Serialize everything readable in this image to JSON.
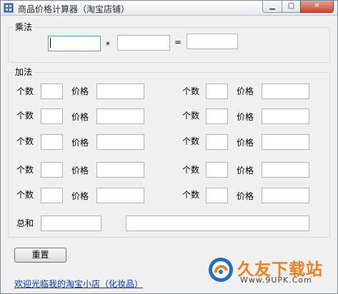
{
  "window": {
    "title": "商品价格计算器（淘宝店铺）",
    "min_icon": "minimize-icon",
    "max_icon": "maximize-icon",
    "close_icon": "close-icon"
  },
  "multiply": {
    "group_label": "乘法",
    "operand1": "",
    "operator": "*",
    "operand2": "",
    "equals": "=",
    "result": ""
  },
  "add": {
    "group_label": "加法",
    "count_label": "个数",
    "price_label": "价格",
    "rows_left": [
      {
        "count": "",
        "price": ""
      },
      {
        "count": "",
        "price": ""
      },
      {
        "count": "",
        "price": ""
      },
      {
        "count": "",
        "price": ""
      },
      {
        "count": "",
        "price": ""
      }
    ],
    "rows_right": [
      {
        "count": "",
        "price": ""
      },
      {
        "count": "",
        "price": ""
      },
      {
        "count": "",
        "price": ""
      },
      {
        "count": "",
        "price": ""
      },
      {
        "count": "",
        "price": ""
      }
    ],
    "total_label": "总和",
    "total_value": "",
    "total_detail": ""
  },
  "reset_button": "重置",
  "footer_link": "欢迎光临我的淘宝小店（化妆品）",
  "watermark": {
    "text": "久友下载站",
    "url": "Www.9UPK.Com"
  }
}
